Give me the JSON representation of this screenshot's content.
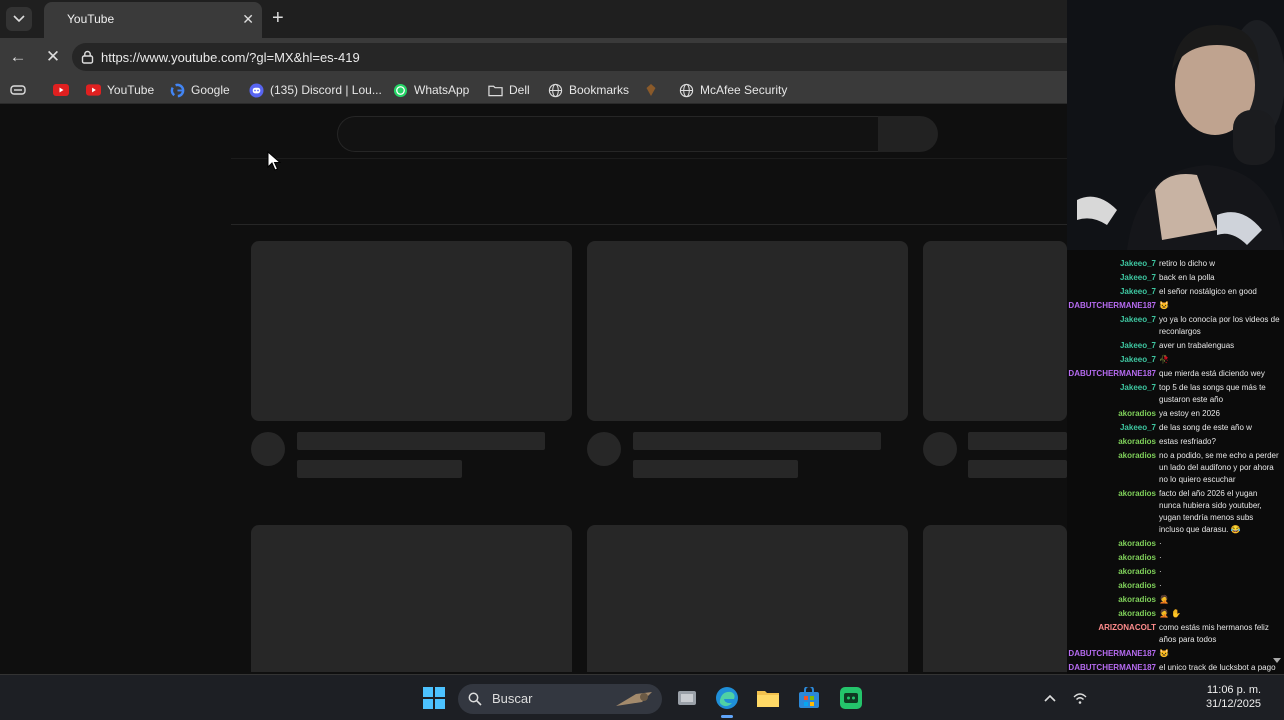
{
  "browser": {
    "tab_title": "YouTube",
    "url": "https://www.youtube.com/?gl=MX&hl=es-419"
  },
  "bookmarks": [
    {
      "label": "YouTube",
      "icon": "youtube-icon"
    },
    {
      "label": "Google",
      "icon": "google-icon"
    },
    {
      "label": "(135) Discord | Lou...",
      "icon": "discord-icon"
    },
    {
      "label": "WhatsApp",
      "icon": "whatsapp-icon"
    },
    {
      "label": "Dell",
      "icon": "folder-icon"
    },
    {
      "label": "Bookmarks",
      "icon": "globe-icon"
    },
    {
      "label": "McAfee Security",
      "icon": "globe-icon"
    }
  ],
  "chat": [
    {
      "user": "Jakeeo_7",
      "msg": "retiro lo dicho w",
      "color": "#3ec7a1"
    },
    {
      "user": "Jakeeo_7",
      "msg": "back en la polla",
      "color": "#3ec7a1"
    },
    {
      "user": "Jakeeo_7",
      "msg": "el señor nostálgico en good",
      "color": "#3ec7a1"
    },
    {
      "user": "DABUTCHERMANE187",
      "msg": "😺",
      "color": "#b66bf0"
    },
    {
      "user": "Jakeeo_7",
      "msg": "yo ya lo conocía por los videos de reconlargos",
      "color": "#3ec7a1"
    },
    {
      "user": "Jakeeo_7",
      "msg": "aver un trabalenguas",
      "color": "#3ec7a1"
    },
    {
      "user": "Jakeeo_7",
      "msg": "🥀",
      "color": "#3ec7a1"
    },
    {
      "user": "DABUTCHERMANE187",
      "msg": "que mierda está diciendo wey",
      "color": "#b66bf0"
    },
    {
      "user": "Jakeeo_7",
      "msg": "top 5 de las songs que más te gustaron este año",
      "color": "#3ec7a1"
    },
    {
      "user": "akoradios",
      "msg": "ya estoy en 2026",
      "color": "#7fd05a"
    },
    {
      "user": "Jakeeo_7",
      "msg": "de las song de este año w",
      "color": "#3ec7a1"
    },
    {
      "user": "akoradios",
      "msg": "estas resfriado?",
      "color": "#7fd05a"
    },
    {
      "user": "akoradios",
      "msg": "no a podido, se me echo a perder un lado del audifono y por ahora no lo quiero escuchar",
      "color": "#7fd05a"
    },
    {
      "user": "akoradios",
      "msg": "facto del año 2026 el yugan nunca hubiera sido youtuber, yugan tendría menos subs incluso que darasu. 😂",
      "color": "#7fd05a"
    },
    {
      "user": "akoradios",
      "msg": "·",
      "color": "#7fd05a"
    },
    {
      "user": "akoradios",
      "msg": "·",
      "color": "#7fd05a"
    },
    {
      "user": "akoradios",
      "msg": "·",
      "color": "#7fd05a"
    },
    {
      "user": "akoradios",
      "msg": "·",
      "color": "#7fd05a"
    },
    {
      "user": "akoradios",
      "msg": "🤦",
      "color": "#7fd05a"
    },
    {
      "user": "akoradios",
      "msg": "🤦 ✋",
      "color": "#7fd05a"
    },
    {
      "user": "ARIZONACOLT",
      "msg": "como estás mis hermanos feliz años para todos",
      "color": "#ff8c8c"
    },
    {
      "user": "DABUTCHERMANE187",
      "msg": "😺",
      "color": "#b66bf0"
    },
    {
      "user": "DABUTCHERMANE187",
      "msg": "el unico track de lucksbot a pago",
      "color": "#b66bf0"
    }
  ],
  "taskbar": {
    "search_label": "Buscar",
    "time": "11:06 p. m.",
    "date": "31/12/2025"
  }
}
